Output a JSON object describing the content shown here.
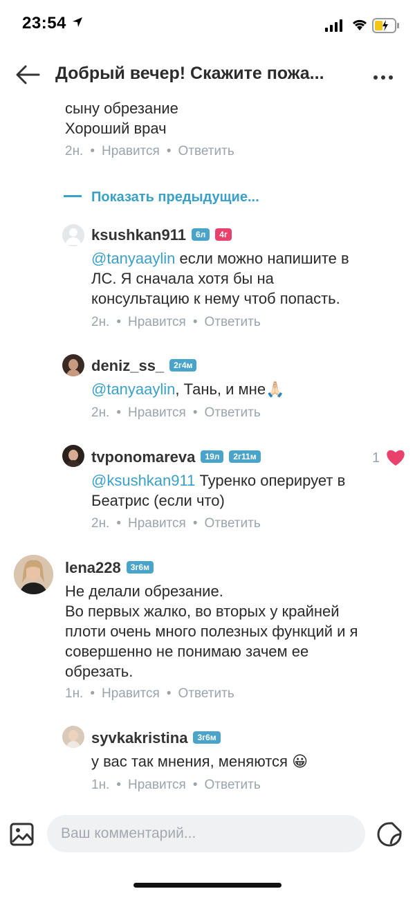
{
  "status": {
    "time": "23:54"
  },
  "header": {
    "title": "Добрый вечер! Скажите пожа..."
  },
  "prev_comment": {
    "line1": "сыну обрезание",
    "line2": "Хороший врач",
    "meta": {
      "time": "2н.",
      "like": "Нравится",
      "reply": "Ответить"
    }
  },
  "show_previous": "Показать предыдущие...",
  "comments": [
    {
      "user": "ksushkan911",
      "badges": [
        "6л",
        "4г"
      ],
      "mention": "@tanyaaylin",
      "text1": " если можно напишите в",
      "text2": "ЛС. Я сначала хотя бы на",
      "text3": "консультацию к нему чтоб попасть.",
      "meta": {
        "time": "2н.",
        "like": "Нравится",
        "reply": "Ответить"
      }
    },
    {
      "user": "deniz_ss_",
      "badges": [
        "2г4м"
      ],
      "mention": "@tanyaaylin",
      "text1": ", Тань, и мне🙏🏻",
      "meta": {
        "time": "2н.",
        "like": "Нравится",
        "reply": "Ответить"
      }
    },
    {
      "user": "tvponomareva",
      "badges": [
        "19л",
        "2г11м"
      ],
      "likes": "1",
      "mention": "@ksushkan911",
      "text1": " Туренко оперирует в",
      "text2": "Беатрис (если что)",
      "meta": {
        "time": "2н.",
        "like": "Нравится",
        "reply": "Ответить"
      }
    },
    {
      "user": "lena228",
      "badges": [
        "3г6м"
      ],
      "text1": "Не делали обрезание.",
      "text2": "Во первых жалко, во вторых у крайней",
      "text3": "плоти очень много полезных функций и я",
      "text4": "совершенно не понимаю зачем ее",
      "text5": "обрезать.",
      "meta": {
        "time": "1н.",
        "like": "Нравится",
        "reply": "Ответить"
      }
    },
    {
      "user": "syvkakristina",
      "badges": [
        "3г6м"
      ],
      "text1": "у вас так мнения, меняются 😀",
      "meta": {
        "time": "1н.",
        "like": "Нравится",
        "reply": "Ответить"
      }
    }
  ],
  "composer": {
    "placeholder": "Ваш комментарий..."
  },
  "colors": {
    "accent": "#3aa0c8",
    "badge_blue": "#4aa3c9",
    "badge_red": "#e8416c",
    "heart": "#e8416c"
  }
}
